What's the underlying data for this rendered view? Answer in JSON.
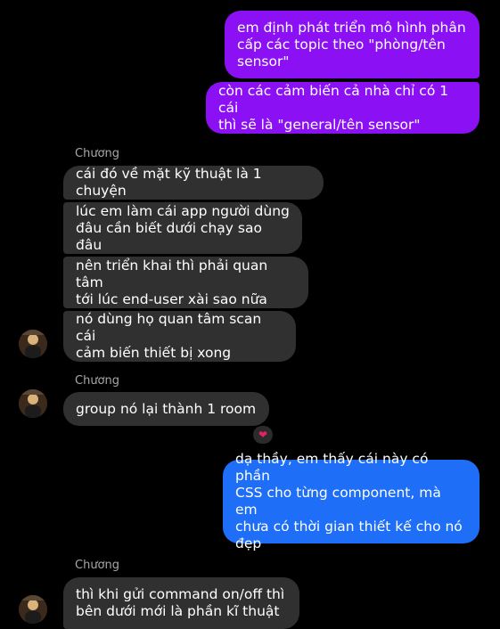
{
  "messages": {
    "m1": "em định phát triển mô hình phân\ncấp các topic theo \"phòng/tên\nsensor\"",
    "m2": "còn các cảm biến cả nhà chỉ có 1 cái\nthì sẽ là \"general/tên sensor\"",
    "m3": "cái đó về mặt kỹ thuật là 1 chuyện",
    "m4": "lúc em làm cái app người dùng\nđâu cần biết dưới chạy sao đâu",
    "m5": "nên triển khai thì phải quan tâm\ntới lúc end-user xài sao nữa",
    "m6": "nó dùng họ quan tâm scan cái\ncảm biến thiết bị xong",
    "m7": "group nó lại thành 1 room",
    "m8": "dạ thầy, em thấy cái này có phần\nCSS cho từng component, mà em\nchưa có thời gian thiết kế cho nó\nđẹp",
    "m9": "thì khi gửi command on/off thì\nbên dưới mới là phần kĩ thuật"
  },
  "sender_name": "Chương",
  "reaction_icon": "heart-icon",
  "reaction_glyph": "❤",
  "colors": {
    "outgoing_purple": "#8b11f4",
    "outgoing_blue": "#1e6ef7",
    "incoming": "#303030",
    "background": "#000000"
  }
}
